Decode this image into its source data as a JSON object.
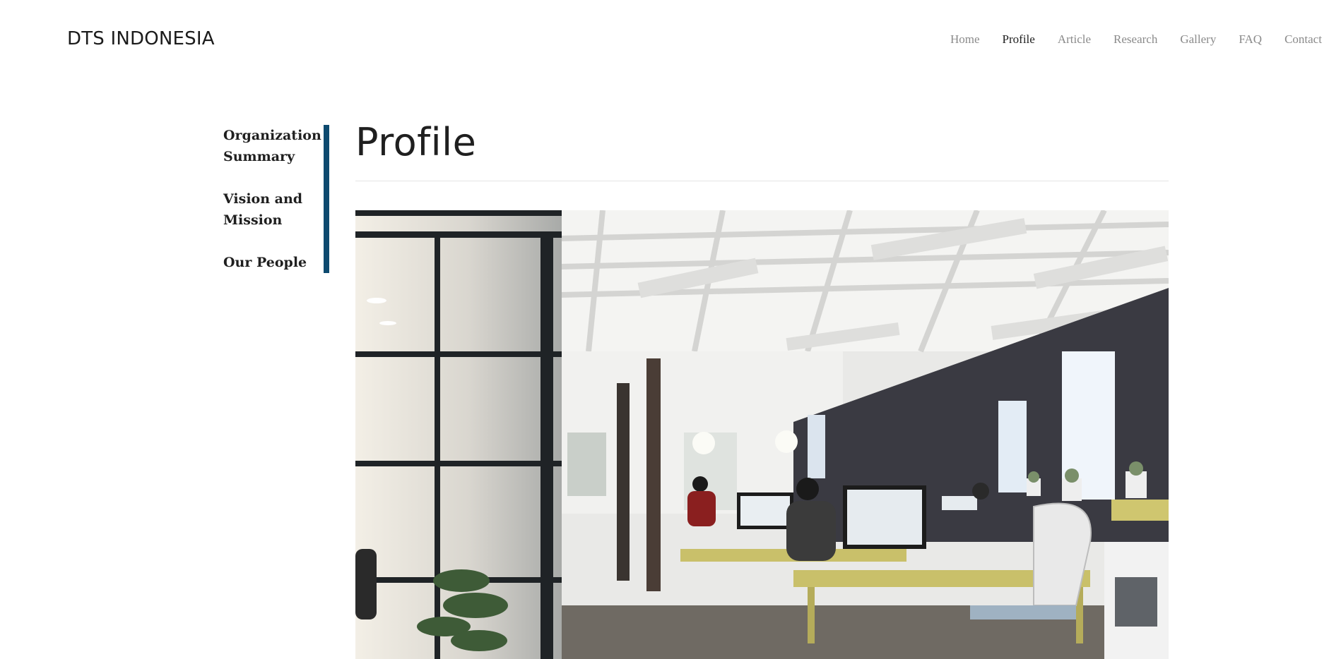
{
  "header": {
    "brand": "DTS INDONESIA",
    "nav": [
      {
        "label": "Home",
        "active": false
      },
      {
        "label": "Profile",
        "active": true
      },
      {
        "label": "Article",
        "active": false
      },
      {
        "label": "Research",
        "active": false
      },
      {
        "label": "Gallery",
        "active": false
      },
      {
        "label": "FAQ",
        "active": false
      },
      {
        "label": "Contact",
        "active": false
      }
    ]
  },
  "sidebar": {
    "items": [
      {
        "label": "Organization Summary"
      },
      {
        "label": "Vision and Mission"
      },
      {
        "label": "Our People"
      }
    ],
    "accent_color": "#0d4a6f"
  },
  "main": {
    "title": "Profile"
  }
}
